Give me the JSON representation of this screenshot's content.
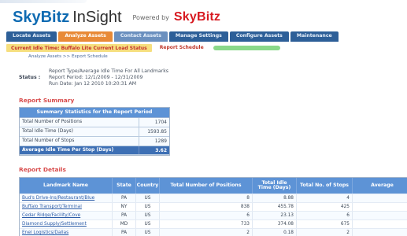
{
  "brand": {
    "skybitz": "SkyBitz",
    "insight": "InSight",
    "powered_by": "Powered by",
    "powered_brand": "SkyBitz"
  },
  "tabs": [
    {
      "label": "Locate Assets"
    },
    {
      "label": "Analyze Assets"
    },
    {
      "label": "Contact Assets"
    },
    {
      "label": "Manage Settings"
    },
    {
      "label": "Configure Assets"
    },
    {
      "label": "Maintenance"
    }
  ],
  "subnav": {
    "left_label": "Current Idle Time: Buffalo Lite Current Load Status",
    "right_label": "Report Schedule"
  },
  "breadcrumb": "Analyze Assets >> Export Schedule",
  "status": {
    "label": "Status :",
    "lines": [
      "Report Type/Average Idle Time For All Landmarks",
      "Report Period: 12/1/2009 - 12/31/2009",
      "Run Date: Jan 12 2010 10:20:31 AM"
    ]
  },
  "report_summary": {
    "title": "Report Summary",
    "table_title": "Summary Statistics for the Report Period",
    "rows": [
      {
        "label": "Total Number of Positions",
        "value": "1704"
      },
      {
        "label": "Total Idle Time (Days)",
        "value": "1593.85"
      },
      {
        "label": "Total Number of Stops",
        "value": "1289"
      },
      {
        "label": "Average Idle Time Per Stop (Days)",
        "value": "3.62"
      }
    ]
  },
  "report_details": {
    "title": "Report Details",
    "headers": [
      "Landmark Name",
      "State",
      "Country",
      "Total Number of Positions",
      "Total Idle Time (Days)",
      "Total No. of Stops",
      "Average"
    ],
    "rows": [
      {
        "landmark": "Bud's Drive-Ins/Restaurant/Blue",
        "state": "PA",
        "country": "US",
        "positions": "8",
        "idle": "8.88",
        "stops": "4",
        "average": ""
      },
      {
        "landmark": "Buffalo Transport/Terminal",
        "state": "NY",
        "country": "US",
        "positions": "838",
        "idle": "455.78",
        "stops": "425",
        "average": ""
      },
      {
        "landmark": "Cedar Ridge/Facility/Cove",
        "state": "PA",
        "country": "US",
        "positions": "6",
        "idle": "23.13",
        "stops": "6",
        "average": ""
      },
      {
        "landmark": "Diamond Supply/Settlement",
        "state": "MD",
        "country": "US",
        "positions": "733",
        "idle": "374.08",
        "stops": "675",
        "average": ""
      },
      {
        "landmark": "Enel Logistics/Dallas",
        "state": "PA",
        "country": "US",
        "positions": "2",
        "idle": "0.18",
        "stops": "2",
        "average": ""
      }
    ]
  }
}
